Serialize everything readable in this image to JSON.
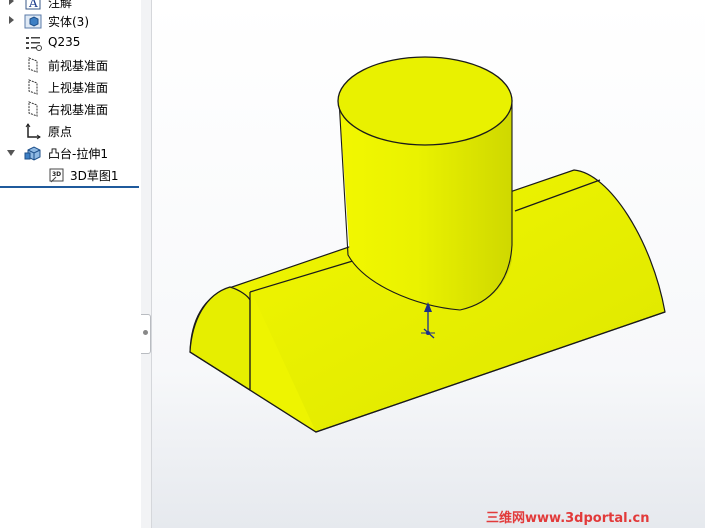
{
  "feature_tree": {
    "items": [
      {
        "label": "注解",
        "icon": "annotation-icon"
      },
      {
        "label": "实体(3)",
        "icon": "solid-bodies-folder-icon"
      },
      {
        "label": "Q235",
        "icon": "material-icon"
      },
      {
        "label": "前视基准面",
        "icon": "plane-icon"
      },
      {
        "label": "上视基准面",
        "icon": "plane-icon"
      },
      {
        "label": "右视基准面",
        "icon": "plane-icon"
      },
      {
        "label": "原点",
        "icon": "origin-icon"
      },
      {
        "label": "凸台-拉伸1",
        "icon": "boss-extrude-icon"
      },
      {
        "label": "3D草图1",
        "icon": "3d-sketch-icon",
        "badge": "3D"
      }
    ]
  },
  "viewport": {
    "model_color": "#e8f000",
    "edge_color": "#1a1a1a",
    "triad_color": "#1b2e8a"
  },
  "watermark": {
    "text": "三维网www.3dportal.cn",
    "color": "#e23a3a"
  }
}
